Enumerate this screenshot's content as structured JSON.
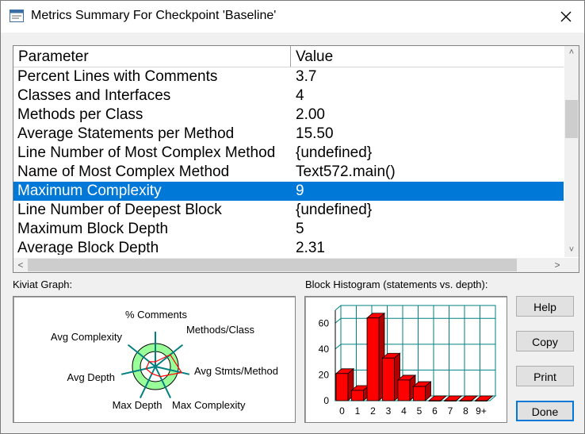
{
  "window": {
    "title": "Metrics Summary For Checkpoint 'Baseline'"
  },
  "table": {
    "columns": [
      "Parameter",
      "Value"
    ],
    "rows": [
      {
        "parameter": "Percent Lines with Comments",
        "value": "3.7"
      },
      {
        "parameter": "Classes and Interfaces",
        "value": "4"
      },
      {
        "parameter": "Methods per Class",
        "value": "2.00"
      },
      {
        "parameter": "Average Statements per Method",
        "value": "15.50"
      },
      {
        "parameter": "Line Number of Most Complex Method",
        "value": "{undefined}"
      },
      {
        "parameter": "Name of Most Complex Method",
        "value": "Text572.main()"
      },
      {
        "parameter": "Maximum Complexity",
        "value": "9",
        "selected": true
      },
      {
        "parameter": "Line Number of Deepest Block",
        "value": "{undefined}"
      },
      {
        "parameter": "Maximum Block Depth",
        "value": "5"
      },
      {
        "parameter": "Average Block Depth",
        "value": "2.31"
      }
    ],
    "selection_color": "#0078d7"
  },
  "kiviat": {
    "label": "Kiviat Graph:",
    "axes": [
      "% Comments",
      "Methods/Class",
      "Avg Stmts/Method",
      "Max Complexity",
      "Max Depth",
      "Avg Depth",
      "Avg Complexity"
    ],
    "ring_color": "#99ff99",
    "axis_color": "#008080",
    "polygon_color": "#ff0000"
  },
  "histogram": {
    "label": "Block Histogram (statements vs. depth):",
    "bar_color": "#ff0000",
    "grid_color": "#008080"
  },
  "chart_data": {
    "type": "bar",
    "title": "Block Histogram (statements vs. depth):",
    "categories": [
      "0",
      "1",
      "2",
      "3",
      "4",
      "5",
      "6",
      "7",
      "8",
      "9+"
    ],
    "values": [
      21,
      8,
      64,
      33,
      16,
      11,
      0,
      0,
      0,
      0
    ],
    "yticks": [
      "0",
      "20",
      "40",
      "60"
    ],
    "ylim": [
      0,
      70
    ],
    "grid": true
  },
  "buttons": {
    "help": "Help",
    "copy": "Copy",
    "print": "Print",
    "done": "Done"
  }
}
